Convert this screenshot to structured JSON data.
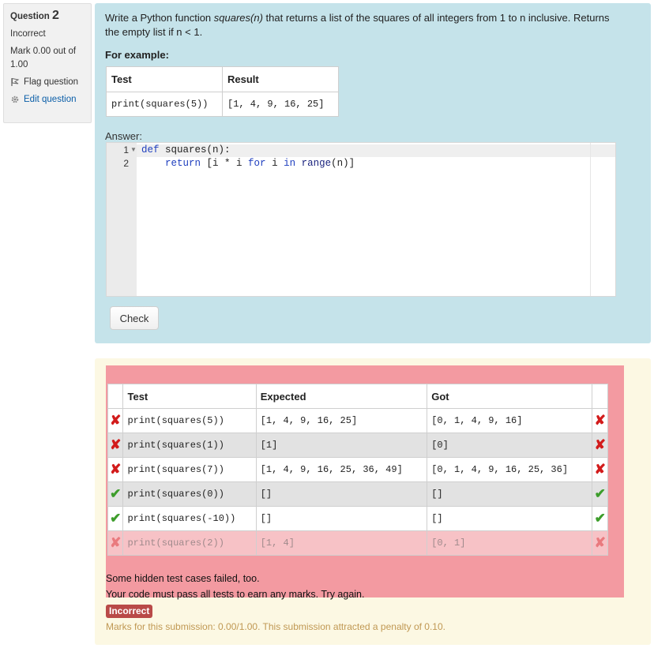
{
  "info": {
    "question_label": "Question",
    "question_number": "2",
    "status": "Incorrect",
    "mark_text": "Mark 0.00 out of 1.00",
    "flag_label": "Flag question",
    "edit_label": "Edit question"
  },
  "question": {
    "text_before": "Write a Python function ",
    "func_name": "squares(n)",
    "text_after": " that returns a list of the squares of all integers from 1 to n inclusive. Returns the empty list if n < 1.",
    "example_heading": "For example:",
    "example_headers": [
      "Test",
      "Result"
    ],
    "example_row": [
      "print(squares(5))",
      "[1, 4, 9, 16, 25]"
    ],
    "answer_label": "Answer:",
    "code_lines": [
      {
        "num": "1",
        "kw": "def",
        "rest": " squares(n):"
      },
      {
        "num": "2",
        "indent": "    ",
        "kw1": "return",
        "mid1": " [i * i ",
        "kw2": "for",
        "mid2": " i ",
        "kw3": "in",
        "fn": " range",
        "end": "(n)]"
      }
    ],
    "check_label": "Check"
  },
  "results": {
    "headers": [
      "Test",
      "Expected",
      "Got"
    ],
    "rows": [
      {
        "status": "fail",
        "test": "print(squares(5))",
        "expected": "[1, 4, 9, 16, 25]",
        "got": "[0, 1, 4, 9, 16]"
      },
      {
        "status": "fail",
        "test": "print(squares(1))",
        "expected": "[1]",
        "got": "[0]"
      },
      {
        "status": "fail",
        "test": "print(squares(7))",
        "expected": "[1, 4, 9, 16, 25, 36, 49]",
        "got": "[0, 1, 4, 9, 16, 25, 36]"
      },
      {
        "status": "pass",
        "test": "print(squares(0))",
        "expected": "[]",
        "got": "[]"
      },
      {
        "status": "pass",
        "test": "print(squares(-10))",
        "expected": "[]",
        "got": "[]"
      },
      {
        "status": "fail",
        "test": "print(squares(2))",
        "expected": "[1, 4]",
        "got": "[0, 1]"
      }
    ],
    "hidden_msg": "Some hidden test cases failed, too.",
    "pass_msg": "Your code must pass all tests to earn any marks. Try again.",
    "badge": "Incorrect",
    "marks_note": "Marks for this submission: 0.00/1.00. This submission attracted a penalty of 0.10."
  },
  "colors": {
    "question_bg": "#c5e3ea",
    "feedback_bg": "#fcf8e3",
    "results_bg": "#f39aa1",
    "cross": "#d21b1b",
    "tick": "#3d9d2b",
    "badge": "#b94a48"
  }
}
